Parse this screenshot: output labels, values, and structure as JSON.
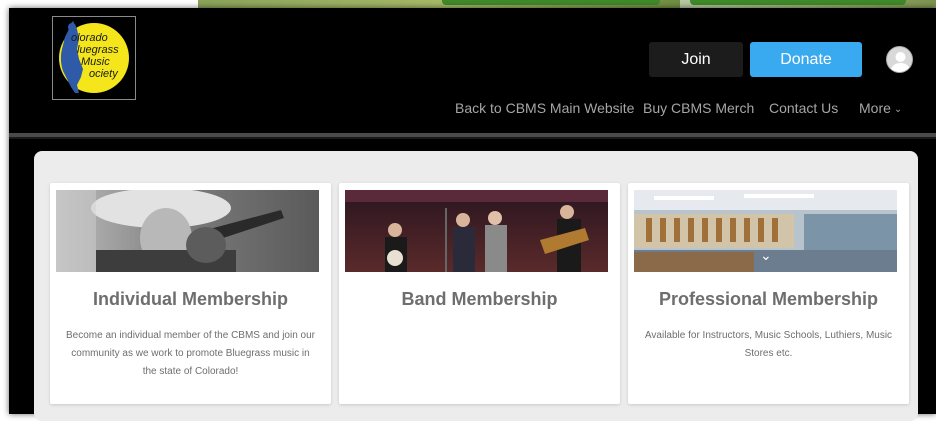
{
  "header": {
    "logo_lines": [
      "olorado",
      "luegrass",
      "Music",
      "ociety"
    ],
    "join_label": "Join",
    "donate_label": "Donate"
  },
  "nav": {
    "items": [
      {
        "label": "Back to CBMS Main Website"
      },
      {
        "label": "Buy CBMS Merch"
      },
      {
        "label": "Contact Us"
      },
      {
        "label": "More"
      }
    ]
  },
  "cards": [
    {
      "title": "Individual Membership",
      "description": "Become an individual member of the CBMS and join our community as we work to promote Bluegrass music in the state of Colorado!"
    },
    {
      "title": "Band Membership",
      "description": ""
    },
    {
      "title": "Professional Membership",
      "description": "Available for Instructors, Music Schools, Luthiers, Music Stores etc."
    }
  ],
  "colors": {
    "donate": "#3aaaf0",
    "join": "#1c1c1c",
    "logo_yellow": "#f4e61a",
    "nav_text": "#a6a6a6",
    "card_title": "#6e6e6e"
  },
  "icons": {
    "avatar": "user-avatar-icon",
    "more": "chevron-down-icon",
    "carousel": "chevron-down-icon"
  }
}
